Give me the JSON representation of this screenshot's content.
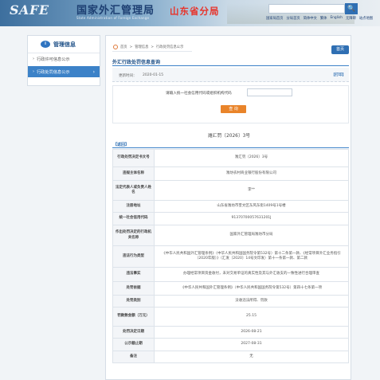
{
  "header": {
    "logo": "SAFE",
    "bureau_cn": "国家外汇管理局",
    "bureau_en": "State Administration of Foreign Exchange",
    "branch": "山东省分局",
    "search_button": "🔍",
    "top_links": [
      "国家局首页",
      "分局首页",
      "简体中文",
      "繁体",
      "English",
      "无障碍",
      "站点地图"
    ]
  },
  "sidebar": {
    "title": "管理信息",
    "icon_text": "i",
    "items": [
      {
        "label": "行政许可信息公示",
        "active": false
      },
      {
        "label": "行政处罚信息公示",
        "active": true
      }
    ]
  },
  "breadcrumb": [
    "首页",
    "管理信息",
    "行政处罚信息公示"
  ],
  "home_button": "首页",
  "page_title": "外汇行政处罚信息查询",
  "meta": {
    "date_label": "更新时间：",
    "date_value": "2020-01-15",
    "print_label": "【打印】"
  },
  "query": {
    "label": "请输入统一社会信用代码或组织机构代码",
    "input_value": "",
    "button": "查 询"
  },
  "doc_no": "潍汇罚〔2026〕3号",
  "back_label": "【返回】",
  "rows": [
    {
      "key": "行政处罚决定书文号",
      "value": "潍汇罚〔2026〕3号",
      "h": 22
    },
    {
      "key": "违规主体名称",
      "value": "潍坊农村商业银行股份有限公司",
      "h": 17
    },
    {
      "key": "法定代表人或负责人姓名",
      "value": "李**",
      "h": 25
    },
    {
      "key": "注册地址",
      "value": "山东省潍坊市奎文区东风东街1409号1号楼",
      "h": 15
    },
    {
      "key": "统一社会信用代码",
      "value": "91370700057631201J",
      "h": 16
    },
    {
      "key": "作出处罚决定的行政机关名称",
      "value": "国家外汇管理局潍坊市分局",
      "h": 26
    },
    {
      "key": "违法行为类型",
      "value": "《中华人民共和国外汇管理条例》（中华人民共和国国务院令第532号）第十二条第一款、《经常项目外汇业务指引（2020年版）》（汇发〔2020〕14号文印发）第十一条第一款、第二款",
      "h": 27
    },
    {
      "key": "违法事实",
      "value": "办理经常项目资金收付，未对交易单证的真实性及其与外汇收支的一致性进行合理审查",
      "h": 18
    },
    {
      "key": "处罚依据",
      "value": "《中华人民共和国外汇管理条例》（中华人民共和国国务院令第532号）第四十七条第一项",
      "h": 17
    },
    {
      "key": "处罚类别",
      "value": "没收违法所得、罚款",
      "h": 15
    },
    {
      "key": "罚款数金额（万元）",
      "value": "25.15",
      "h": 24
    },
    {
      "key": "处罚决定日期",
      "value": "2026-08-21",
      "h": 15
    },
    {
      "key": "公示截止期",
      "value": "2027-08-31",
      "h": 16
    },
    {
      "key": "备注",
      "value": "无",
      "h": 15
    }
  ]
}
